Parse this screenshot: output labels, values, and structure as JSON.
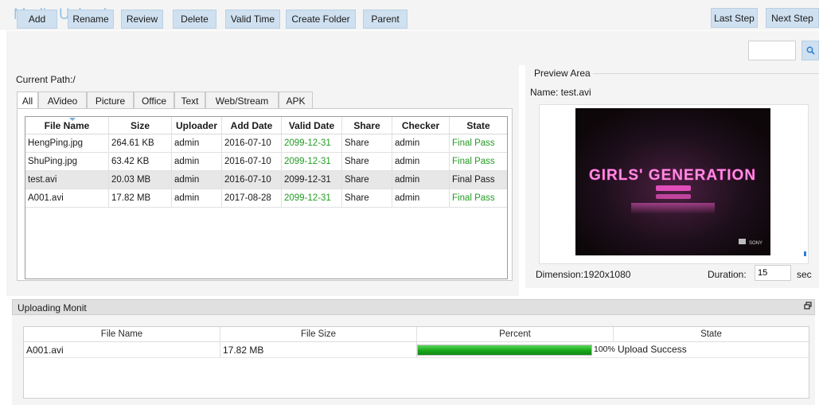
{
  "app": {
    "title": "Media Upload",
    "last_step_label": "Last Step",
    "next_step_label": "Next Step"
  },
  "toolbar": {
    "buttons": [
      "Add",
      "Rename",
      "Review",
      "Delete",
      "Valid Time",
      "Create Folder",
      "Parent"
    ],
    "search": {
      "value": "",
      "icon": "search-icon"
    }
  },
  "path": {
    "label": "Current Path:/"
  },
  "tabs": [
    "All",
    "AVideo",
    "Picture",
    "Office",
    "Text",
    "Web/Stream",
    "APK"
  ],
  "active_tab": "All",
  "file_table": {
    "columns": [
      "File Name",
      "Size",
      "Uploader",
      "Add Date",
      "Valid Date",
      "Share",
      "Checker",
      "State"
    ],
    "rows": [
      [
        "HengPing.jpg",
        "264.61 KB",
        "admin",
        "2016-07-10",
        "2099-12-31",
        "Share",
        "admin",
        "Final Pass"
      ],
      [
        "ShuPing.jpg",
        "63.42 KB",
        "admin",
        "2016-07-10",
        "2099-12-31",
        "Share",
        "admin",
        "Final Pass"
      ],
      [
        "test.avi",
        "20.03 MB",
        "admin",
        "2016-07-10",
        "2099-12-31",
        "Share",
        "admin",
        "Final Pass"
      ],
      [
        "A001.avi",
        "17.82 MB",
        "admin",
        "2017-08-28",
        "2099-12-31",
        "Share",
        "admin",
        "Final Pass"
      ]
    ],
    "selected_row": 2
  },
  "preview": {
    "title": "Preview Area",
    "name_label": "Name: test.avi",
    "thumbnail_text": "GIRLS' GENERATION",
    "thumbnail_logo": "SONY",
    "dimension_label": "Dimension:1920x1080",
    "duration_label": "Duration:",
    "duration_value": "15",
    "duration_unit": "sec"
  },
  "monit": {
    "title": "Uploading Monit",
    "columns": [
      "File Name",
      "File Size",
      "Percent",
      "State"
    ],
    "rows": [
      {
        "file_name": "A001.avi",
        "file_size": "17.82 MB",
        "percent_label": "100%",
        "percent_value": 100,
        "state": "Upload Success"
      }
    ]
  },
  "colors": {
    "title": "#8ec1e4",
    "button_bg": "#cfe0f0",
    "panel_bg": "#f4f4f4",
    "pass_green": "#239b23",
    "progress_green": "#1aa71a",
    "thumb_pink": "#f05cc8"
  }
}
